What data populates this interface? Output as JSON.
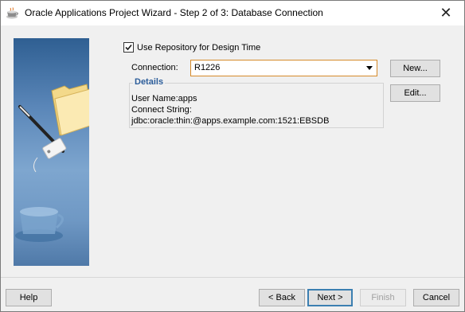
{
  "window": {
    "title": "Oracle Applications Project Wizard - Step 2 of 3: Database Connection",
    "close_icon": "close-icon",
    "app_icon": "coffee-cup-icon"
  },
  "form": {
    "use_repository_label": "Use Repository for Design Time",
    "use_repository_checked": true,
    "connection_label": "Connection:",
    "connection_value": "R1226",
    "new_button": "New...",
    "edit_button": "Edit..."
  },
  "details": {
    "title": "Details",
    "user_name": "User Name:apps",
    "connect_string_label": "Connect String:",
    "connect_string_value": "jdbc:oracle:thin:@apps.example.com:1521:EBSDB"
  },
  "footer": {
    "help": "Help",
    "back": "< Back",
    "next": "Next >",
    "finish": "Finish",
    "cancel": "Cancel"
  },
  "colors": {
    "accent": "#3c7fb1",
    "select_border": "#d58a2a",
    "details_title": "#2c5d9a"
  }
}
